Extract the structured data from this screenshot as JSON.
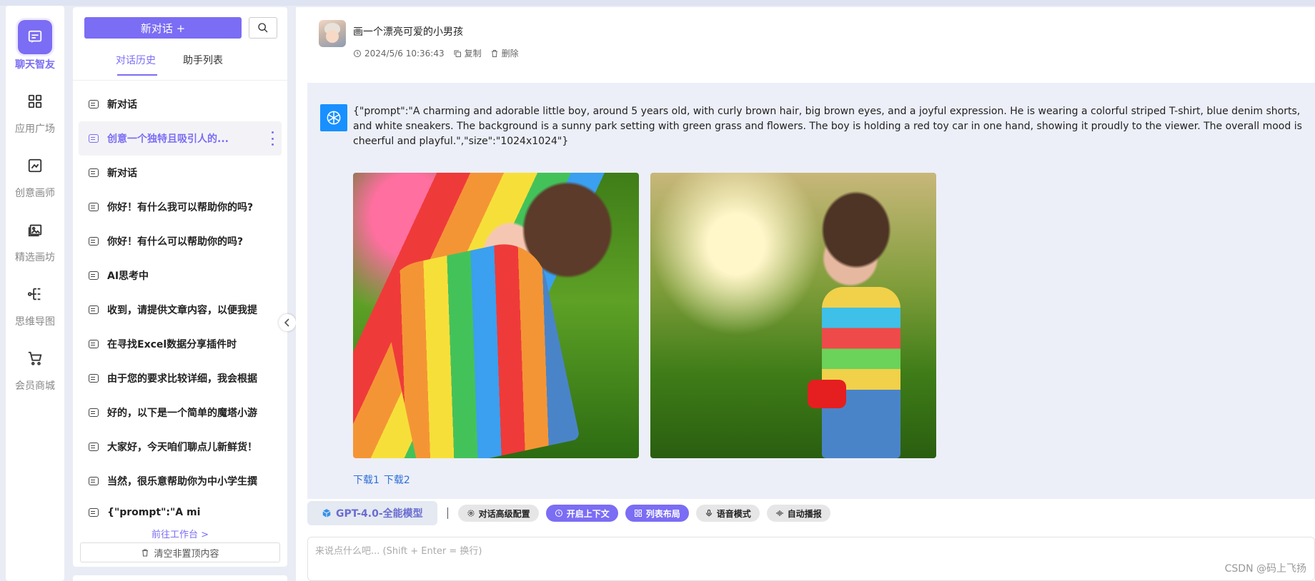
{
  "rail": {
    "items": [
      {
        "label": "聊天智友",
        "icon": "chat-icon",
        "active": true
      },
      {
        "label": "应用广场",
        "icon": "grid-icon"
      },
      {
        "label": "创意画师",
        "icon": "draw-icon"
      },
      {
        "label": "精选画坊",
        "icon": "gallery-icon"
      },
      {
        "label": "思维导图",
        "icon": "mindmap-icon"
      },
      {
        "label": "会员商城",
        "icon": "cart-icon"
      }
    ]
  },
  "sidebar": {
    "new_chat_label": "新对话 +",
    "tabs": [
      "对话历史",
      "助手列表"
    ],
    "conversations": [
      "新对话",
      "创意一个独特且吸引人的...",
      "新对话",
      "你好！有什么我可以帮助你的吗?",
      "你好！有什么可以帮助你的吗?",
      "AI思考中",
      "收到，请提供文章内容，以便我提",
      "在寻找Excel数据分享插件时",
      "由于您的要求比较详细，我会根据",
      "好的，以下是一个简单的魔塔小游",
      "大家好，今天咱们聊点儿新鲜货！",
      "当然，很乐意帮助你为中小学生撰",
      "{\"prompt\":\"A mi"
    ],
    "workbench_link": "前往工作台 >",
    "clear_label": "清空非置顶内容"
  },
  "chat": {
    "user_message": "画一个漂亮可爱的小男孩",
    "timestamp": "2024/5/6 10:36:43",
    "copy_label": "复制",
    "delete_label": "删除",
    "bot_text": "{\"prompt\":\"A charming and adorable little boy, around 5 years old, with curly brown hair, big brown eyes, and a joyful expression. He is wearing a colorful striped T-shirt, blue denim shorts, and white sneakers. The background is a sunny park setting with green grass and flowers. The boy is holding a red toy car in one hand, showing it proudly to the viewer. The overall mood is cheerful and playful.\",\"size\":\"1024x1024\"}",
    "download1": "下载1",
    "download2": "下载2"
  },
  "toolbar": {
    "model": "GPT-4.0-全能模型",
    "chips": [
      "对话高级配置",
      "开启上下文",
      "列表布局",
      "语音模式",
      "自动播报"
    ]
  },
  "input": {
    "placeholder": "来说点什么吧... (Shift + Enter = 换行)"
  },
  "watermark": "CSDN @码上飞扬",
  "colors": {
    "accent": "#7b6df4",
    "link": "#2f6fd6",
    "bot_avatar": "#1890ff"
  }
}
